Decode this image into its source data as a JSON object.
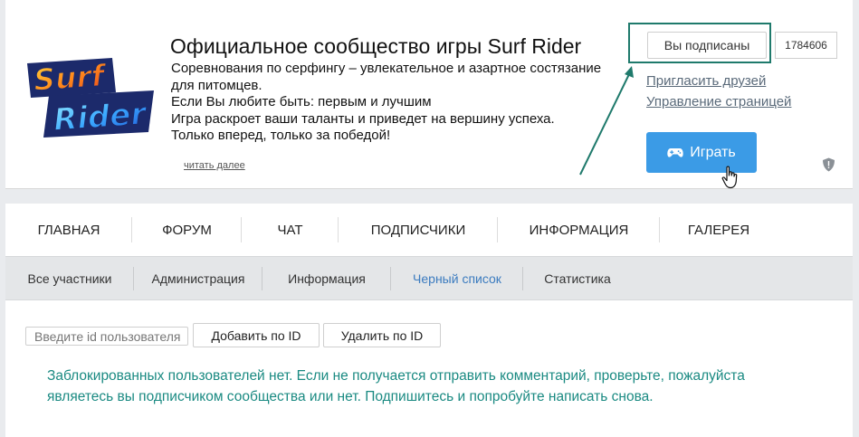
{
  "header": {
    "logo_text_line1": "Surf",
    "logo_text_line2": "Rider",
    "title": "Официальное сообщество игры Surf Rider",
    "description": [
      "Соревнования по серфингу – увлекательное и азартное состязание",
      "для питомцев.",
      "Если Вы любите быть: первым и лучшим",
      "Игра раскроет ваши таланты и приведет на вершину успеха.",
      "Только вперед, только за победой!"
    ],
    "read_more": "читать далее"
  },
  "actions": {
    "subscribed_label": "Вы подписаны",
    "subscribers_count": "1784606",
    "invite_label": "Пригласить друзей",
    "manage_label": "Управление страницей",
    "play_label": "Играть"
  },
  "main_tabs": [
    "ГЛАВНАЯ",
    "ФОРУМ",
    "ЧАТ",
    "ПОДПИСЧИКИ",
    "ИНФОРМАЦИЯ",
    "ГАЛЕРЕЯ"
  ],
  "sub_tabs": [
    "Все участники",
    "Администрация",
    "Информация",
    "Черный список",
    "Статистика"
  ],
  "active_sub_tab": "Черный список",
  "blacklist": {
    "id_placeholder": "Введите id пользователя",
    "add_label": "Добавить по ID",
    "remove_label": "Удалить по ID",
    "empty_message": [
      "Заблокированных пользователей нет. Если не получается отправить комментарий, проверьте, пожалуйста",
      "являетесь вы подписчиком сообщества или нет. Подпишитесь и попробуйте написать снова."
    ]
  },
  "colors": {
    "page_bg": "#e9ebee",
    "play_button": "#3b9be6",
    "active_tab": "#3b7bbf",
    "notice_text": "#1a8a82",
    "highlight_frame": "#1f7a6c"
  }
}
